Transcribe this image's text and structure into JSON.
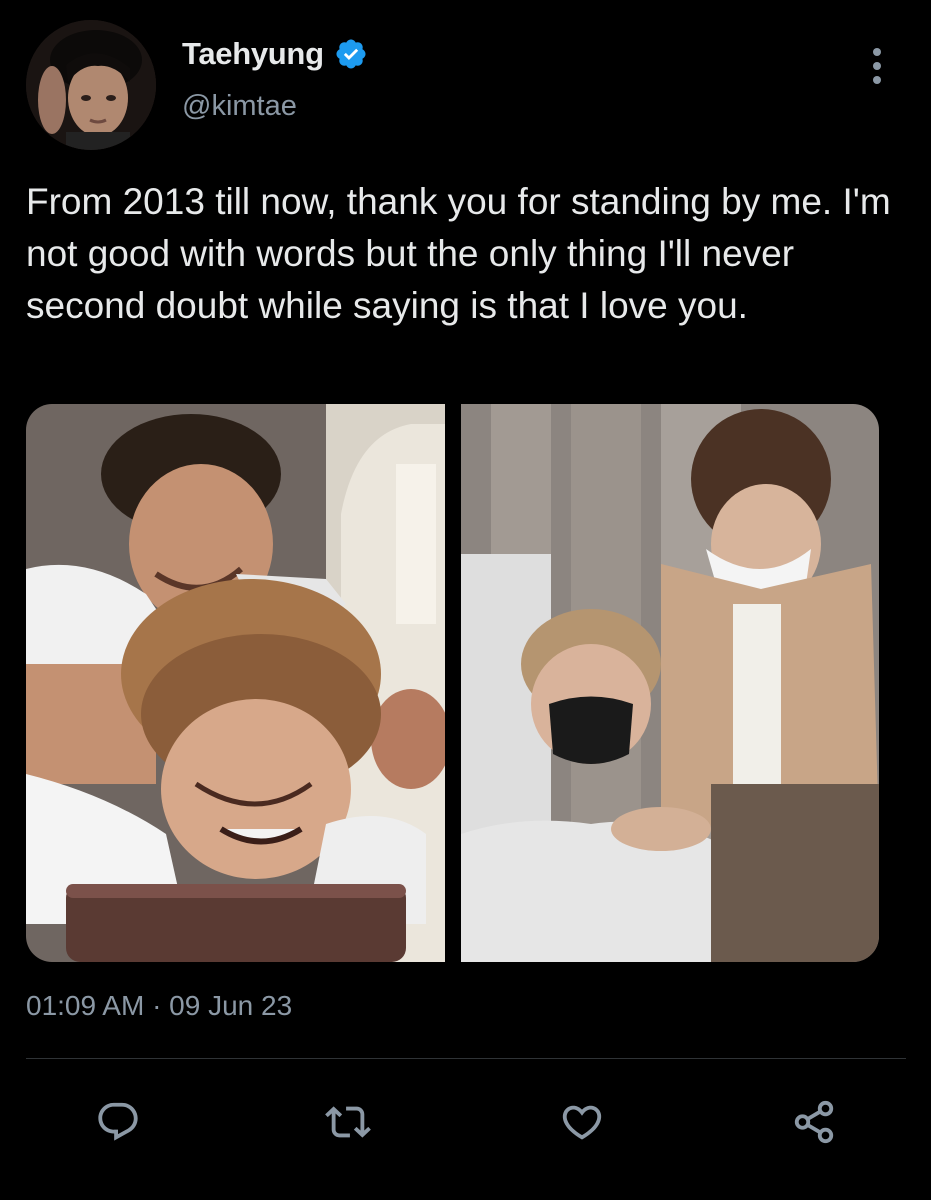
{
  "tweet": {
    "display_name": "Taehyung",
    "handle": "@kimtae",
    "verified": true,
    "text": "From 2013 till now, thank you for standing by me. I'm not good with words but the only thing I'll never second doubt while saying is that I love you.",
    "timestamp": "01:09 AM · 09 Jun 23"
  },
  "media": {
    "count": 2,
    "photos": [
      {
        "icon": "photo-two-people-shoulder-massage"
      },
      {
        "icon": "photo-masked-people-shoulder-touch"
      }
    ]
  },
  "actions": [
    {
      "name": "reply",
      "icon": "reply-icon"
    },
    {
      "name": "retweet",
      "icon": "retweet-icon"
    },
    {
      "name": "like",
      "icon": "heart-icon"
    },
    {
      "name": "share",
      "icon": "share-icon"
    }
  ],
  "colors": {
    "background": "#000000",
    "text_primary": "#e7e9ea",
    "text_secondary": "#8b98a5",
    "verified_blue": "#1d9bf0",
    "divider": "#2f3336"
  }
}
